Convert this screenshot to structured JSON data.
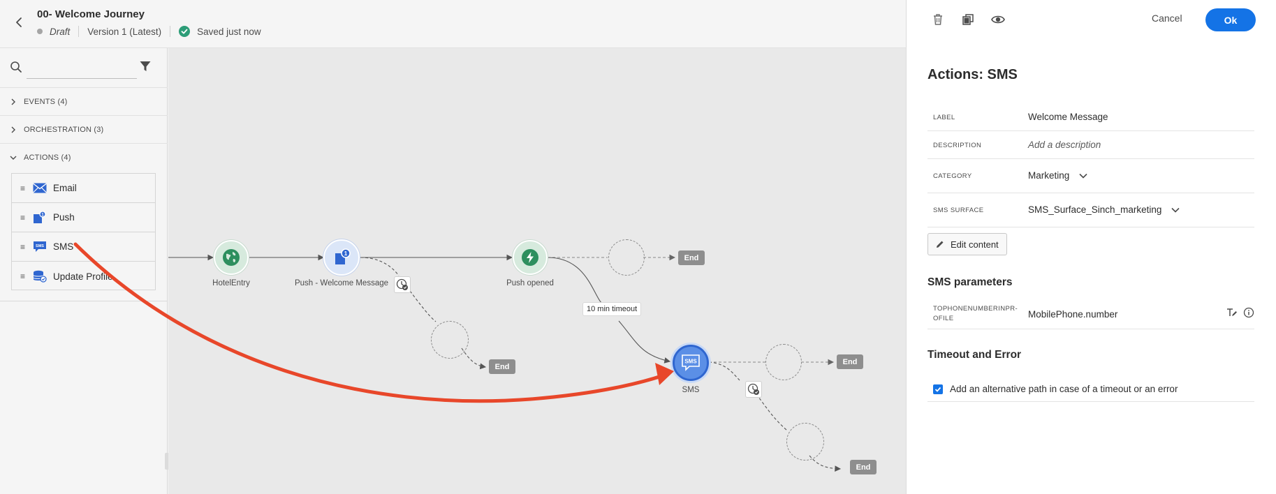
{
  "header": {
    "title": "00- Welcome Journey",
    "status": "Draft",
    "version": "Version 1 (Latest)",
    "saved": "Saved just now"
  },
  "palette": {
    "search_placeholder": "",
    "sections": {
      "events": "EVENTS (4)",
      "orchestration": "ORCHESTRATION (3)",
      "actions": "ACTIONS (4)"
    },
    "actions": [
      {
        "label": "Email",
        "icon": "email-icon"
      },
      {
        "label": "Push",
        "icon": "push-icon"
      },
      {
        "label": "SMS",
        "icon": "sms-icon"
      },
      {
        "label": "Update Profile",
        "icon": "update-profile-icon"
      }
    ]
  },
  "canvas": {
    "nodes": {
      "hotel_entry": "HotelEntry",
      "push_welcome": "Push - Welcome Message",
      "push_opened": "Push opened",
      "sms": "SMS"
    },
    "sms_node_text": "SMS",
    "push_badge": "1",
    "timeout_label": "10 min timeout",
    "end_label": "End"
  },
  "panel": {
    "cancel": "Cancel",
    "ok": "Ok",
    "title": "Actions: SMS",
    "label_key": "LABEL",
    "label_value": "Welcome Message",
    "description_key": "DESCRIPTION",
    "description_placeholder": "Add a description",
    "category_key": "CATEGORY",
    "category_value": "Marketing",
    "surface_key": "SMS SURFACE",
    "surface_value": "SMS_Surface_Sinch_marketing",
    "edit_content": "Edit content",
    "sms_parameters": "SMS parameters",
    "param_key_line1": "TOPHONENUMBERINPR-",
    "param_key_line2": "OFILE",
    "param_value": "MobilePhone.number",
    "timeout_error": "Timeout and Error",
    "alt_path": "Add an alternative path in case of a timeout or an error",
    "alt_path_checked": true
  },
  "colors": {
    "accent": "#1473e6",
    "annotation_arrow": "#e8472a",
    "node_green": "#2d8f5e",
    "node_blue": "#2f66d0"
  }
}
